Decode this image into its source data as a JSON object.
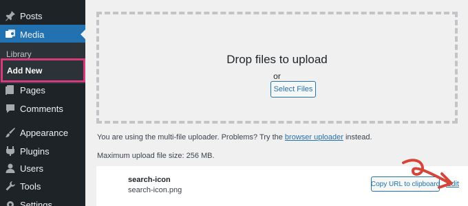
{
  "sidebar": {
    "items": [
      {
        "label": "Posts",
        "icon": "pin-icon"
      },
      {
        "label": "Media",
        "icon": "media-icon"
      },
      {
        "label": "Pages",
        "icon": "pages-icon"
      },
      {
        "label": "Comments",
        "icon": "comments-icon"
      },
      {
        "label": "Appearance",
        "icon": "brush-icon"
      },
      {
        "label": "Plugins",
        "icon": "plugin-icon"
      },
      {
        "label": "Users",
        "icon": "users-icon"
      },
      {
        "label": "Tools",
        "icon": "tools-icon"
      },
      {
        "label": "Settings",
        "icon": "settings-icon"
      }
    ],
    "submenu": {
      "library": "Library",
      "add_new": "Add New"
    }
  },
  "uploader": {
    "drop_title": "Drop files to upload",
    "or": "or",
    "select_files": "Select Files",
    "multi_prefix": "You are using the multi-file uploader. Problems? Try the ",
    "browser_uploader": "browser uploader",
    "multi_suffix": " instead.",
    "max_size": "Maximum upload file size: 256 MB."
  },
  "file": {
    "title": "search-icon",
    "filename": "search-icon.png",
    "copy_url": "Copy URL to clipboard",
    "edit": "Edit"
  },
  "colors": {
    "accent": "#2271b1",
    "highlight": "#d63a7c",
    "arrow": "#d5453a",
    "sidebar": "#1d2327"
  }
}
